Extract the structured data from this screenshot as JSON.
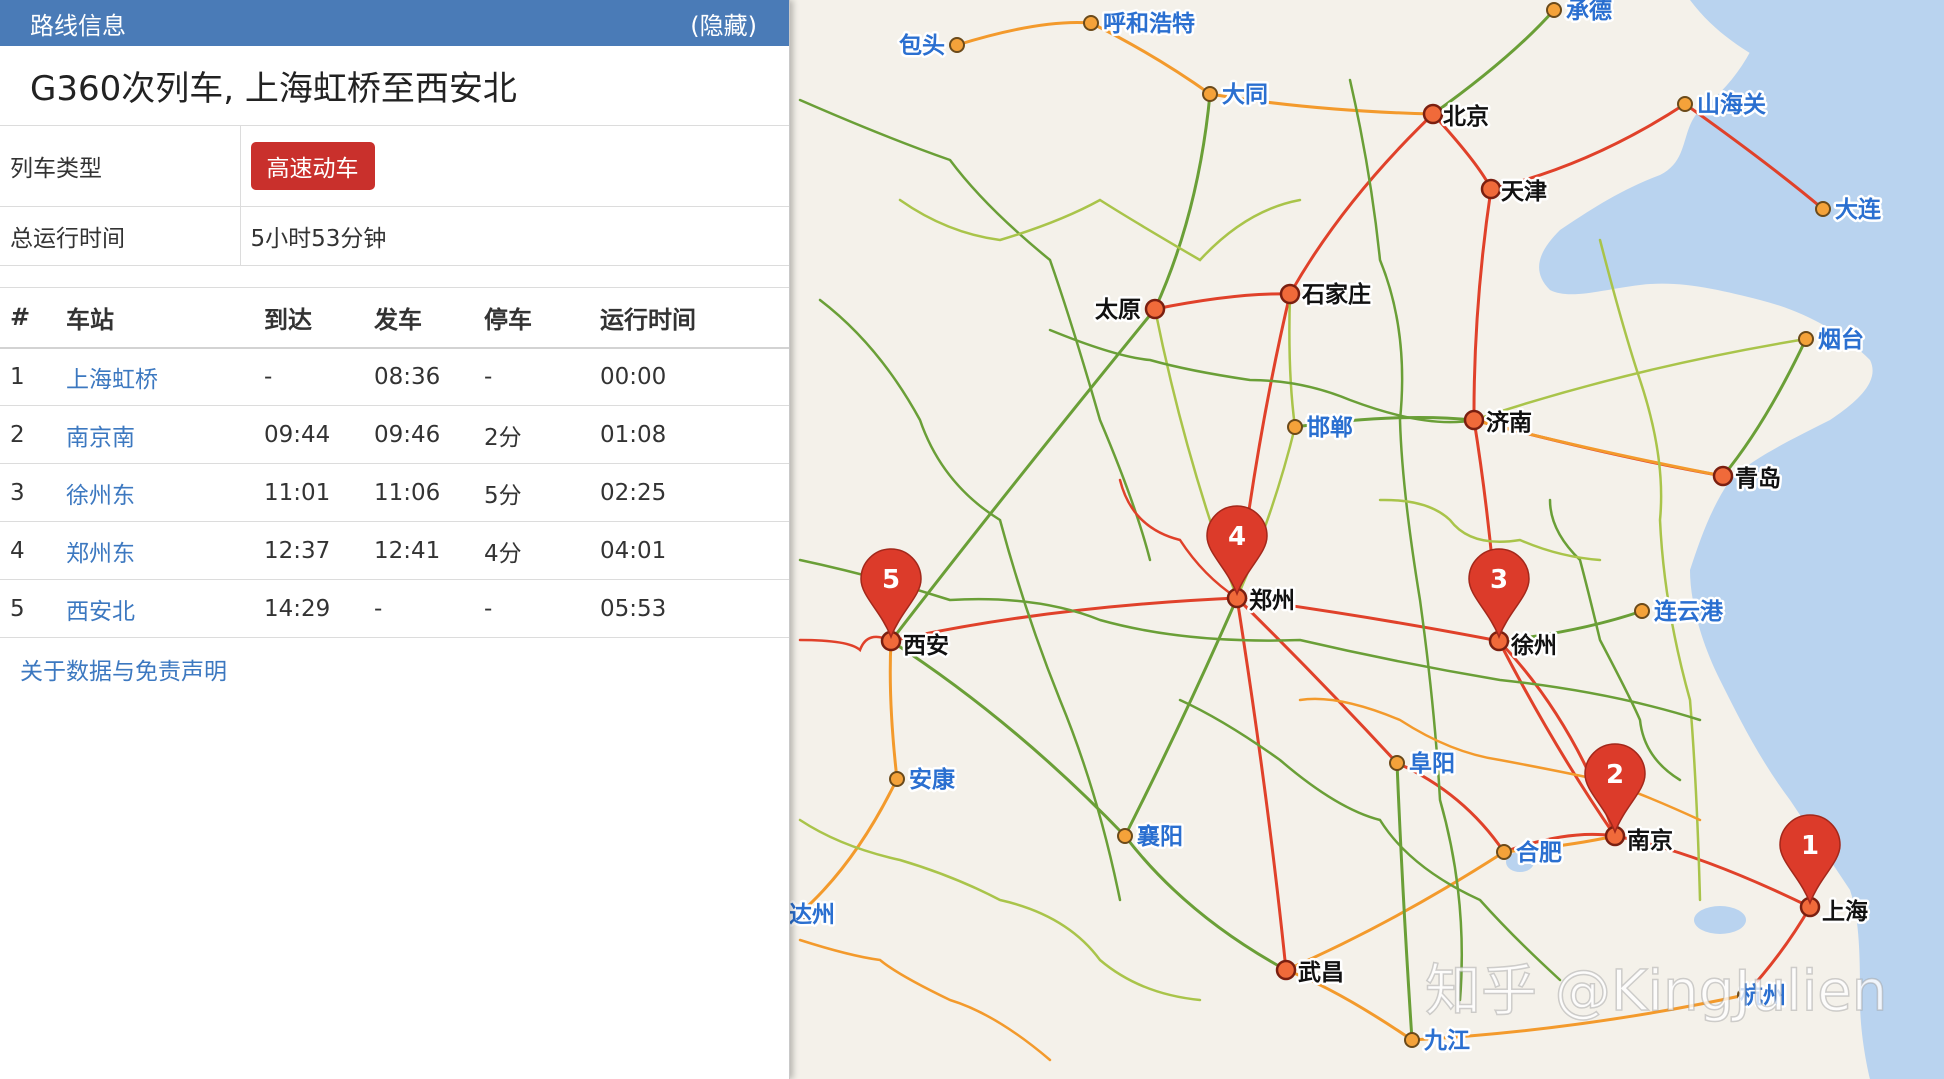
{
  "panel": {
    "header_title": "路线信息",
    "hide_label": "(隐藏)",
    "train_title": "G360次列车, 上海虹桥至西安北",
    "info": {
      "type_label": "列车类型",
      "type_value": "高速动车",
      "duration_label": "总运行时间",
      "duration_value": "5小时53分钟"
    },
    "columns": [
      "#",
      "车站",
      "到达",
      "发车",
      "停车",
      "运行时间"
    ],
    "stops": [
      {
        "no": "1",
        "station": "上海虹桥",
        "arrive": "-",
        "depart": "08:36",
        "stop": "-",
        "elapsed": "00:00"
      },
      {
        "no": "2",
        "station": "南京南",
        "arrive": "09:44",
        "depart": "09:46",
        "stop": "2分",
        "elapsed": "01:08"
      },
      {
        "no": "3",
        "station": "徐州东",
        "arrive": "11:01",
        "depart": "11:06",
        "stop": "5分",
        "elapsed": "02:25"
      },
      {
        "no": "4",
        "station": "郑州东",
        "arrive": "12:37",
        "depart": "12:41",
        "stop": "4分",
        "elapsed": "04:01"
      },
      {
        "no": "5",
        "station": "西安北",
        "arrive": "14:29",
        "depart": "-",
        "stop": "-",
        "elapsed": "05:53"
      }
    ],
    "disclaimer": "关于数据与免责声明"
  },
  "map": {
    "cities_major": [
      "北京",
      "天津",
      "石家庄",
      "太原",
      "济南",
      "青岛",
      "郑州",
      "徐州",
      "西安",
      "南京",
      "上海",
      "武昌"
    ],
    "cities_minor": [
      "呼和浩特",
      "包头",
      "大同",
      "承德",
      "山海关",
      "大连",
      "烟台",
      "邯郸",
      "连云港",
      "阜阳",
      "合肥",
      "安康",
      "襄阳",
      "达州",
      "九江",
      "杭州"
    ],
    "pins": [
      "1",
      "2",
      "3",
      "4",
      "5"
    ],
    "colors": {
      "sea": "#b9d3ef",
      "land": "#f4f1ea",
      "rail_red": "#e0412a",
      "rail_orange": "#f39a2c",
      "rail_green": "#6a9f37",
      "rail_lime": "#a9c44a",
      "pin": "#dc3b2a",
      "panel_header": "#4a7bb7",
      "badge": "#c9302c",
      "link": "#3c78c0"
    }
  },
  "watermark": "知乎 @KingJulien"
}
